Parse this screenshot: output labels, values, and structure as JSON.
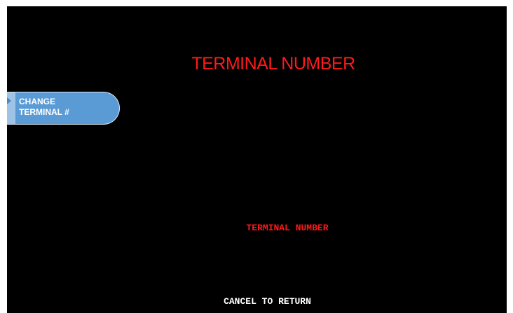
{
  "screen": {
    "title": "TERMINAL NUMBER",
    "field_label": "TERMINAL NUMBER",
    "footer": "CANCEL TO RETURN"
  },
  "buttons": {
    "left_1": {
      "label": "CHANGE\nTERMINAL #"
    }
  },
  "colors": {
    "background": "#000000",
    "title": "#ff1a1a",
    "button": "#5a9bd5",
    "footer": "#ffffff"
  }
}
